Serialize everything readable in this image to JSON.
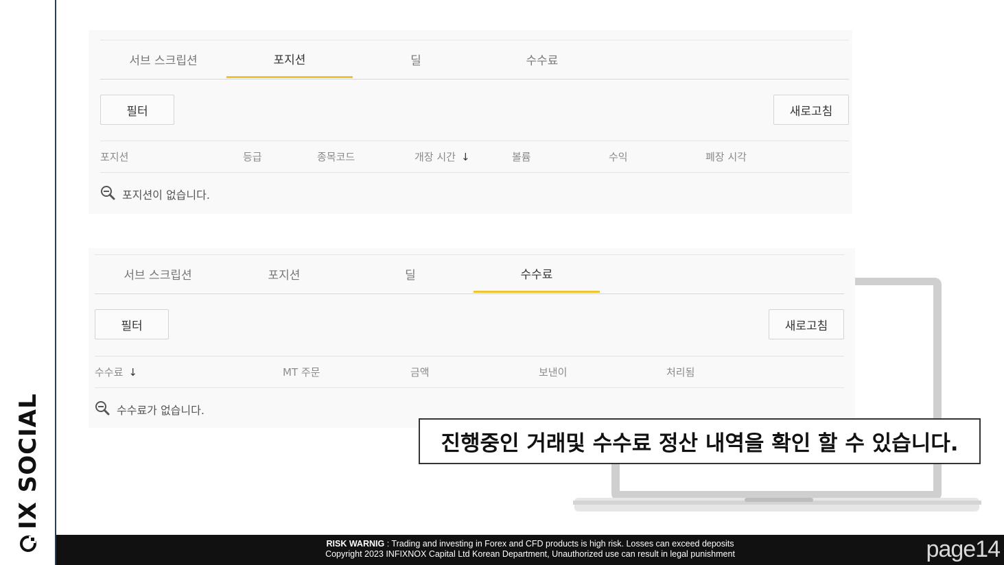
{
  "brand": {
    "name": "IX SOCIAL"
  },
  "panels": [
    {
      "tabs": [
        {
          "label": "서브 스크립션",
          "active": false
        },
        {
          "label": "포지션",
          "active": true
        },
        {
          "label": "딜",
          "active": false
        },
        {
          "label": "수수료",
          "active": false
        }
      ],
      "filter_label": "필터",
      "refresh_label": "새로고침",
      "columns": [
        "포지션",
        "등급",
        "종목코드",
        "개장 시간",
        "볼륨",
        "수익",
        "폐장 시각"
      ],
      "sort_column_index": 3,
      "empty_message": "포지션이 없습니다."
    },
    {
      "tabs": [
        {
          "label": "서브 스크립션",
          "active": false
        },
        {
          "label": "포지션",
          "active": false
        },
        {
          "label": "딜",
          "active": false
        },
        {
          "label": "수수료",
          "active": true
        }
      ],
      "filter_label": "필터",
      "refresh_label": "새로고침",
      "columns": [
        "수수료",
        "MT 주문",
        "금액",
        "보낸이",
        "처리됨"
      ],
      "sort_column_index": 0,
      "empty_message": "수수료가 없습니다."
    }
  ],
  "caption": "진행중인 거래및 수수료 정산 내역을 확인 할 수 있습니다.",
  "footer": {
    "risk_label": "RISK WARNIG",
    "risk_text": " : Trading and investing in Forex and CFD products is high risk. Losses can exceed deposits",
    "copyright": "Copyright 2023 INFIXNOX Capital Ltd Korean Department, Unauthorized use can result in legal punishment",
    "page": "page14"
  },
  "colors": {
    "accent": "#f0c431",
    "brand_line": "#2b3a55",
    "footer_bg": "#111111"
  },
  "icons": {
    "sort": "arrow-down-icon",
    "empty": "zoom-out-icon"
  }
}
